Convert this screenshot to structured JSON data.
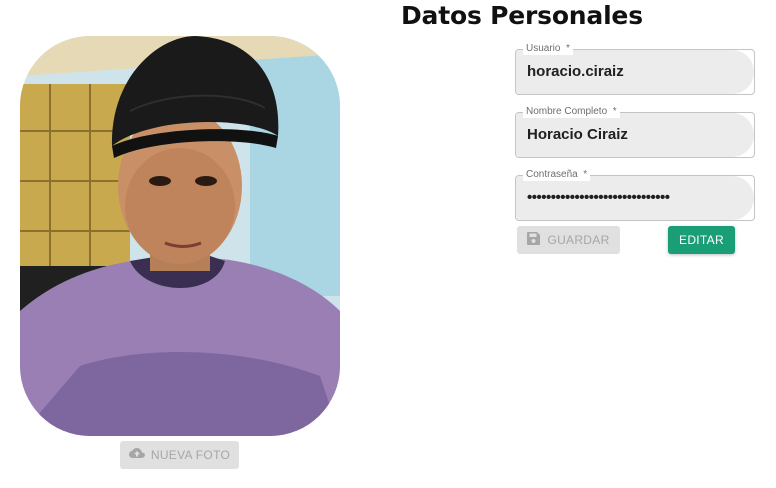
{
  "header": {
    "title": "Datos Personales"
  },
  "profile": {
    "photo_icon": "profile-photo",
    "upload_icon": "cloud-upload-icon",
    "upload_label": "NUEVA FOTO"
  },
  "form": {
    "username": {
      "label": "Usuario",
      "required": "*",
      "value": "horacio.ciraiz"
    },
    "fullname": {
      "label": "Nombre Completo",
      "required": "*",
      "value": "Horacio Ciraiz"
    },
    "password": {
      "label": "Contraseña",
      "required": "*",
      "value": "••••••••••••••••••••••••••••••"
    }
  },
  "actions": {
    "save_icon": "floppy-disk-icon",
    "save_label": "GUARDAR",
    "edit_label": "EDITAR"
  },
  "colors": {
    "accent": "#1a9e75",
    "disabled_bg": "#e0e0e0",
    "disabled_text": "#a6a6a6"
  }
}
